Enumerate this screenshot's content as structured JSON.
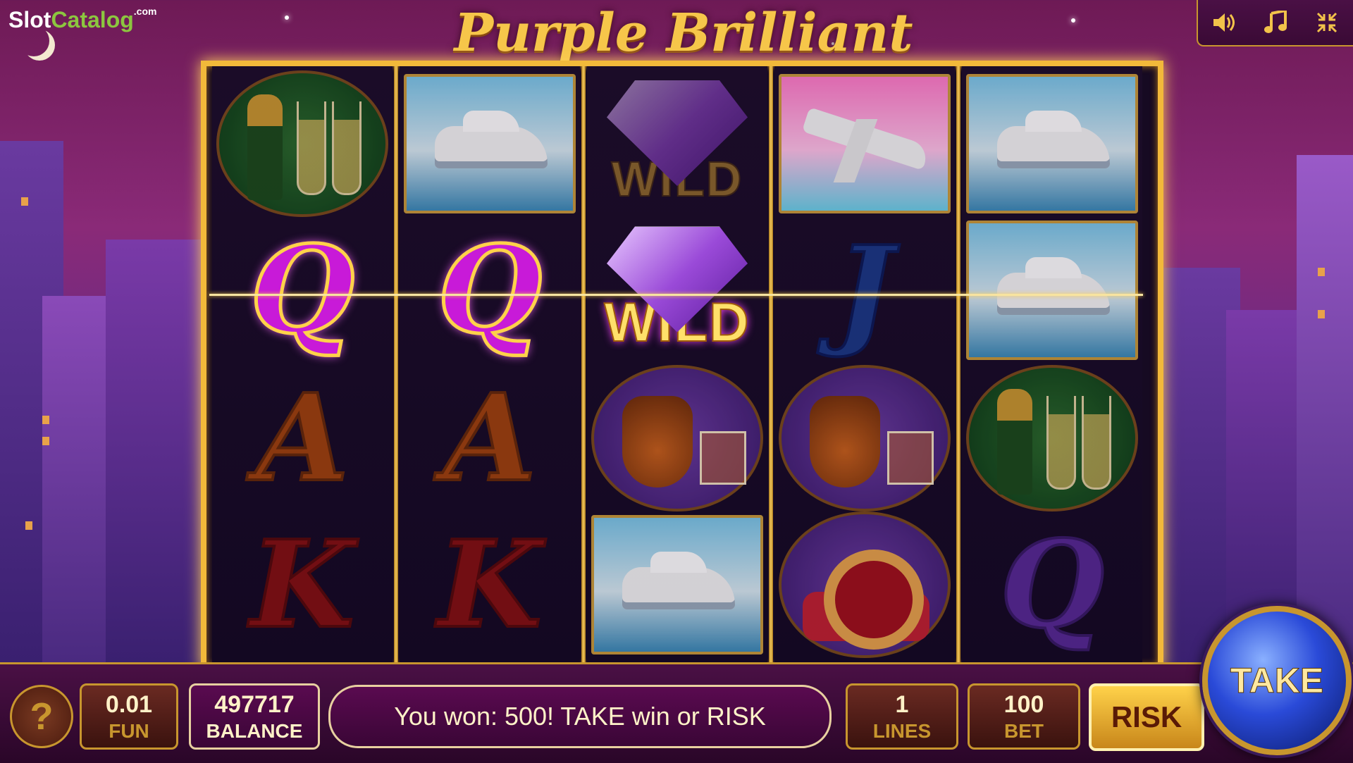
{
  "watermark": {
    "brand_a": "Slot",
    "brand_b": "Catalog",
    "suffix": ".com"
  },
  "title": "Purple Brilliant",
  "top_controls": {
    "sound_icon": "speaker-icon",
    "music_icon": "music-note-icon",
    "minimize_icon": "minimize-icon"
  },
  "reels": [
    [
      "champagne",
      "Q",
      "A",
      "K"
    ],
    [
      "yacht",
      "Q",
      "A",
      "K"
    ],
    [
      "WILD",
      "WILD",
      "cognac",
      "yacht"
    ],
    [
      "jet",
      "J",
      "cognac",
      "ring"
    ],
    [
      "yacht",
      "yacht",
      "champagne",
      "Q"
    ]
  ],
  "wild_label": "WILD",
  "letters": {
    "q": "Q",
    "a": "A",
    "k": "K",
    "j": "J"
  },
  "bottom": {
    "coin_value": "0.01",
    "coin_label": "FUN",
    "balance_value": "497717",
    "balance_label": "BALANCE",
    "message": "You won: 500! TAKE win or RISK",
    "lines_value": "1",
    "lines_label": "LINES",
    "bet_value": "100",
    "bet_label": "BET",
    "risk_label": "RISK",
    "take_label": "TAKE",
    "help_label": "?"
  }
}
